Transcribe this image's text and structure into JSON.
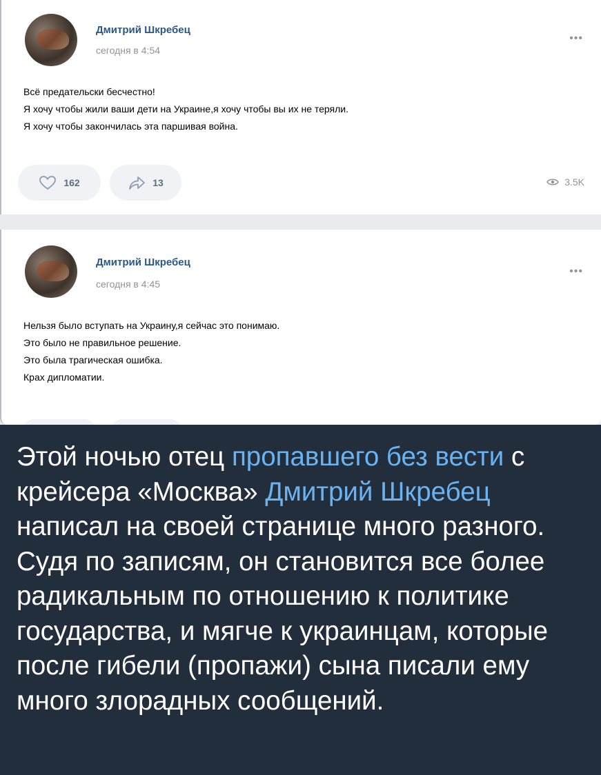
{
  "posts": [
    {
      "author": "Дмитрий Шкребец",
      "time": "сегодня в 4:54",
      "more": "•••",
      "lines": [
        "Всё предательски бесчестно!",
        "Я хочу чтобы жили ваши дети на Украине,я хочу чтобы вы их не теряли.",
        "Я хочу чтобы закончилась эта паршивая война."
      ],
      "likes": "162",
      "shares": "13",
      "views": "3.5K"
    },
    {
      "author": "Дмитрий Шкребец",
      "time": "сегодня в 4:45",
      "more": "•••",
      "lines": [
        "Нельзя было вступать на Украину,я сейчас это понимаю.",
        "Это было не правильное решение.",
        "Это была трагическая ошибка.",
        "Крах дипломатии."
      ]
    }
  ],
  "caption": {
    "part1": "Этой ночью отец ",
    "link1": "пропавшего без вести",
    "part2": " с крейсера «Москва» ",
    "link2": "Дмитрий Шкребец",
    "part3": " написал на своей странице много разного. Судя по записям, он становится все более радикальным по отношению к политике государства, и мягче к украинцам, которые после гибели (пропажи) сына писали ему много злорадных сообщений."
  },
  "colors": {
    "author_link": "#2a5885",
    "caption_background": "#232e3c",
    "caption_link": "#6ab3f3"
  }
}
